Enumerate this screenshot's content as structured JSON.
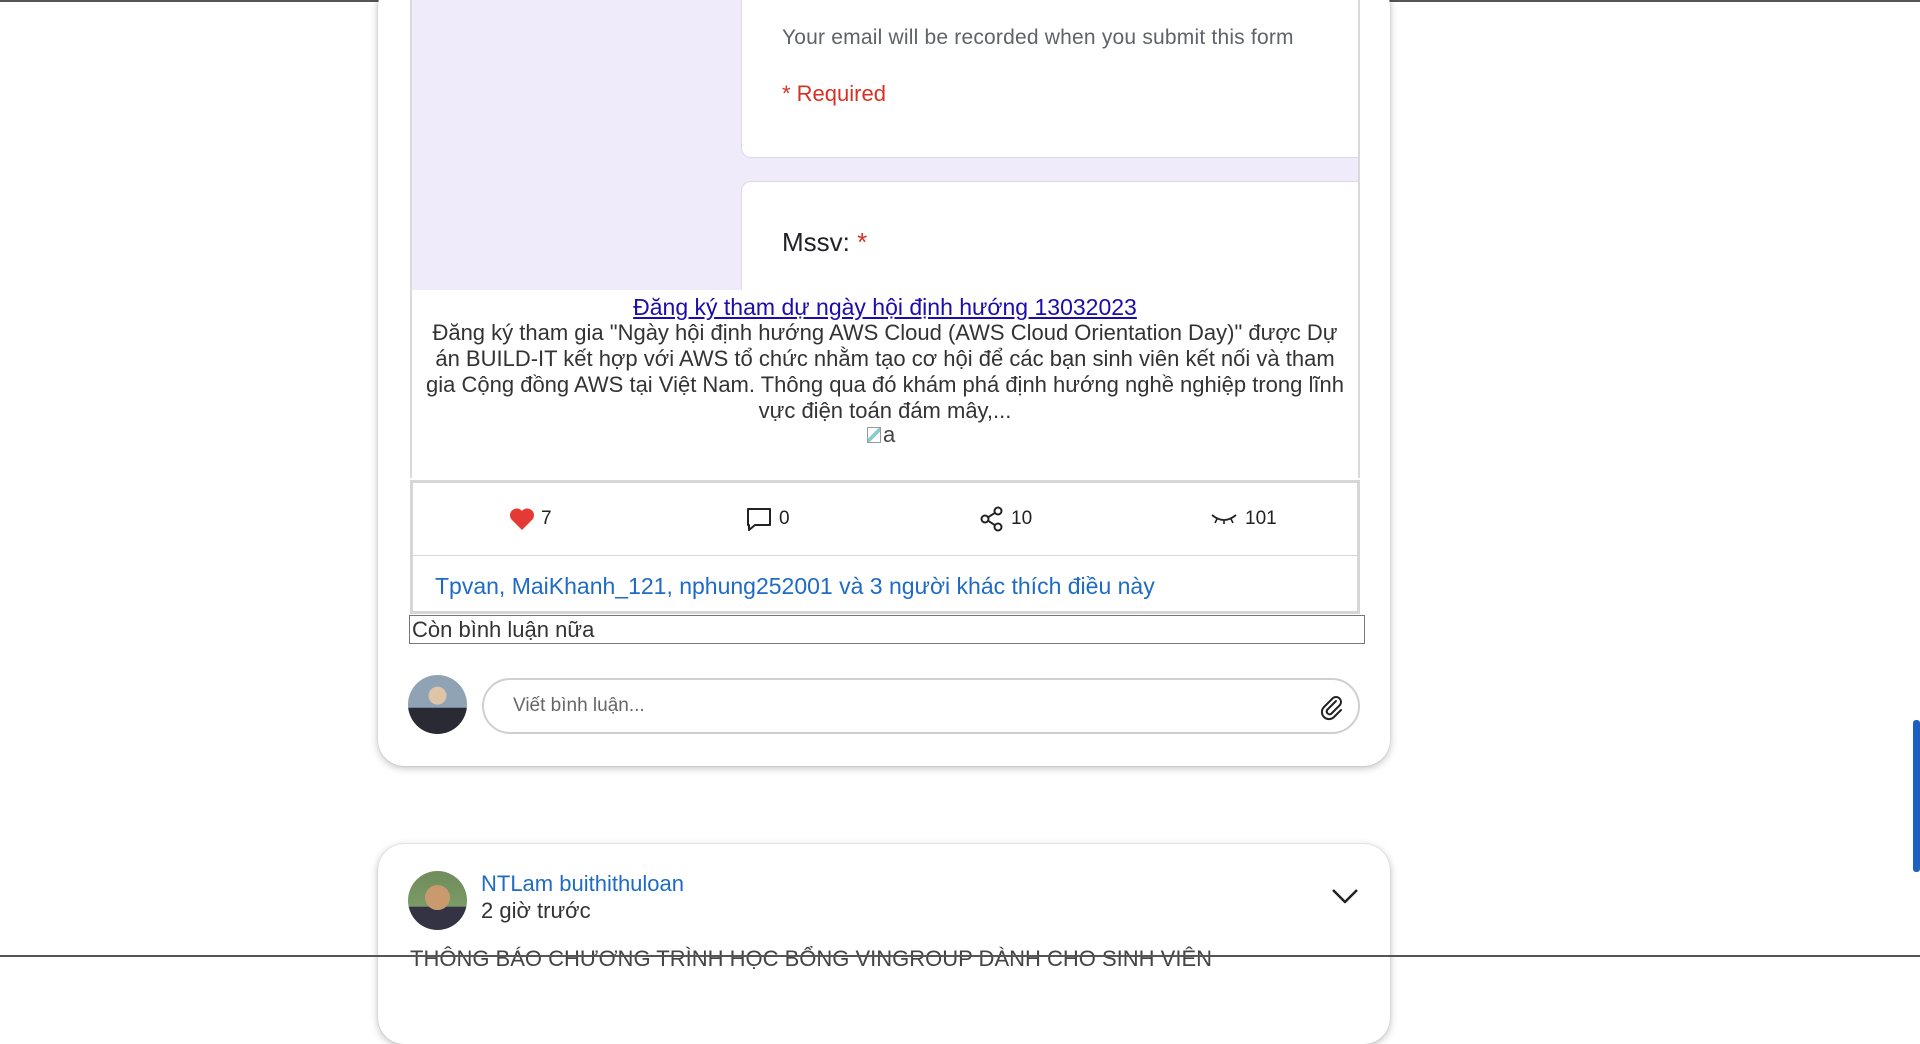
{
  "post1": {
    "preview": {
      "form_email_notice": "Your email will be recorded when you submit this form",
      "form_required": "* Required",
      "form_field_label": "Mssv:",
      "form_field_required_mark": "*",
      "title": "Đăng ký tham dự ngày hội định hướng 13032023",
      "description": "Đăng ký tham gia \"Ngày hội định hướng AWS Cloud (AWS Cloud Orientation Day)\" được Dự án BUILD-IT kết hợp với AWS tổ chức nhằm tạo cơ hội để các bạn sinh viên kết nối và tham gia Cộng đồng AWS tại Việt Nam. Thông qua đó khám phá định hướng nghề nghiệp trong lĩnh vực điện toán đám mây,...",
      "image_alt": "a"
    },
    "reactions": {
      "likes": "7",
      "comments": "0",
      "shares": "10",
      "views": "101"
    },
    "likes_summary": "Tpvan, MaiKhanh_121, nphung252001 và 3 người khác thích điều này",
    "more_comments": "Còn bình luận nữa",
    "comment_input": {
      "placeholder": "Viết bình luận..."
    }
  },
  "post2": {
    "author": "NTLam buithithuloan",
    "time": "2 giờ trước",
    "preview_text": "THÔNG BÁO CHƯƠNG TRÌNH HỌC BỔNG VINGROUP DÀNH CHO SINH VIÊN"
  },
  "colors": {
    "link_blue": "#1e6bc5",
    "like_red": "#e53935",
    "form_bg": "#efebfa",
    "scroll_thumb": "#1e5fc2"
  },
  "icons": {
    "like": "heart-icon",
    "comment": "comment-icon",
    "share": "share-icon",
    "view": "eye-closed-icon",
    "attach": "paperclip-icon",
    "menu": "chevron-down-icon"
  }
}
